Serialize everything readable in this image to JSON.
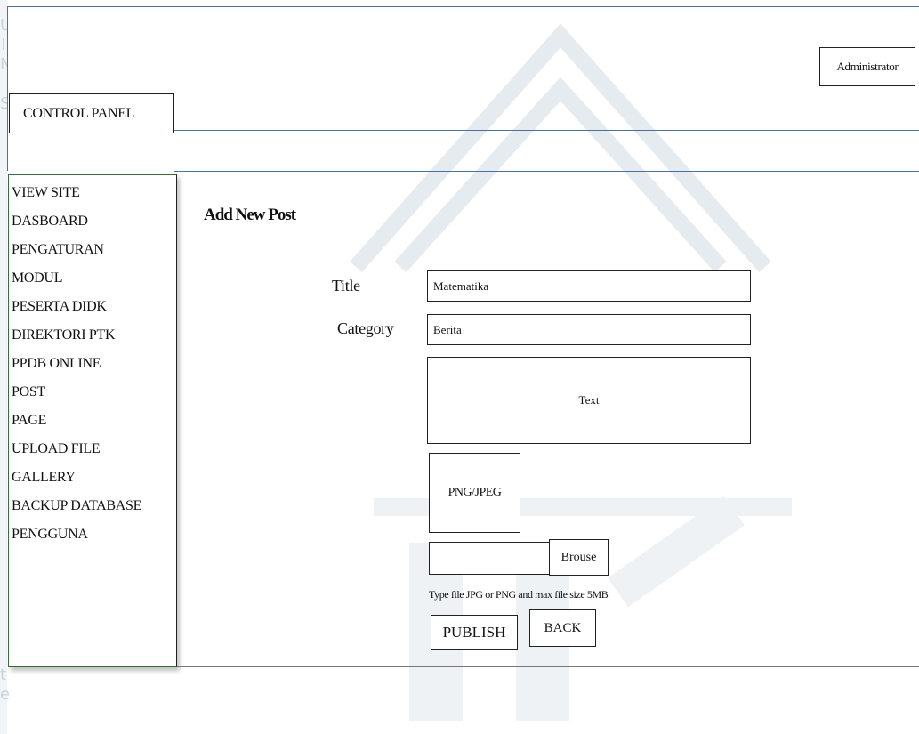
{
  "header": {
    "user_label": "Administrator",
    "panel_label": "CONTROL PANEL"
  },
  "sidebar": {
    "items": [
      {
        "label": "VIEW SITE"
      },
      {
        "label": "DASBOARD"
      },
      {
        "label": "PENGATURAN"
      },
      {
        "label": "MODUL"
      },
      {
        "label": "PESERTA DIDK"
      },
      {
        "label": "DIREKTORI PTK"
      },
      {
        "label": "PPDB ONLINE"
      },
      {
        "label": "POST"
      },
      {
        "label": "PAGE"
      },
      {
        "label": "UPLOAD FILE"
      },
      {
        "label": "GALLERY"
      },
      {
        "label": "BACKUP DATABASE"
      },
      {
        "label": "PENGGUNA"
      }
    ]
  },
  "main": {
    "title": "Add New Post",
    "form": {
      "title_label": "Title",
      "title_value": "Matematika",
      "category_label": "Category",
      "category_value": "Berita",
      "text_placeholder": "Text",
      "image_label": "PNG/JPEG",
      "browse_label": "Brouse",
      "hint": "Type file JPG or PNG and max file size 5MB",
      "publish_label": "PUBLISH",
      "back_label": "BACK"
    }
  },
  "colors": {
    "header_line": "#4a6fa5",
    "sidebar_border": "#3a6b3a",
    "watermark": "#c9d3dc"
  }
}
